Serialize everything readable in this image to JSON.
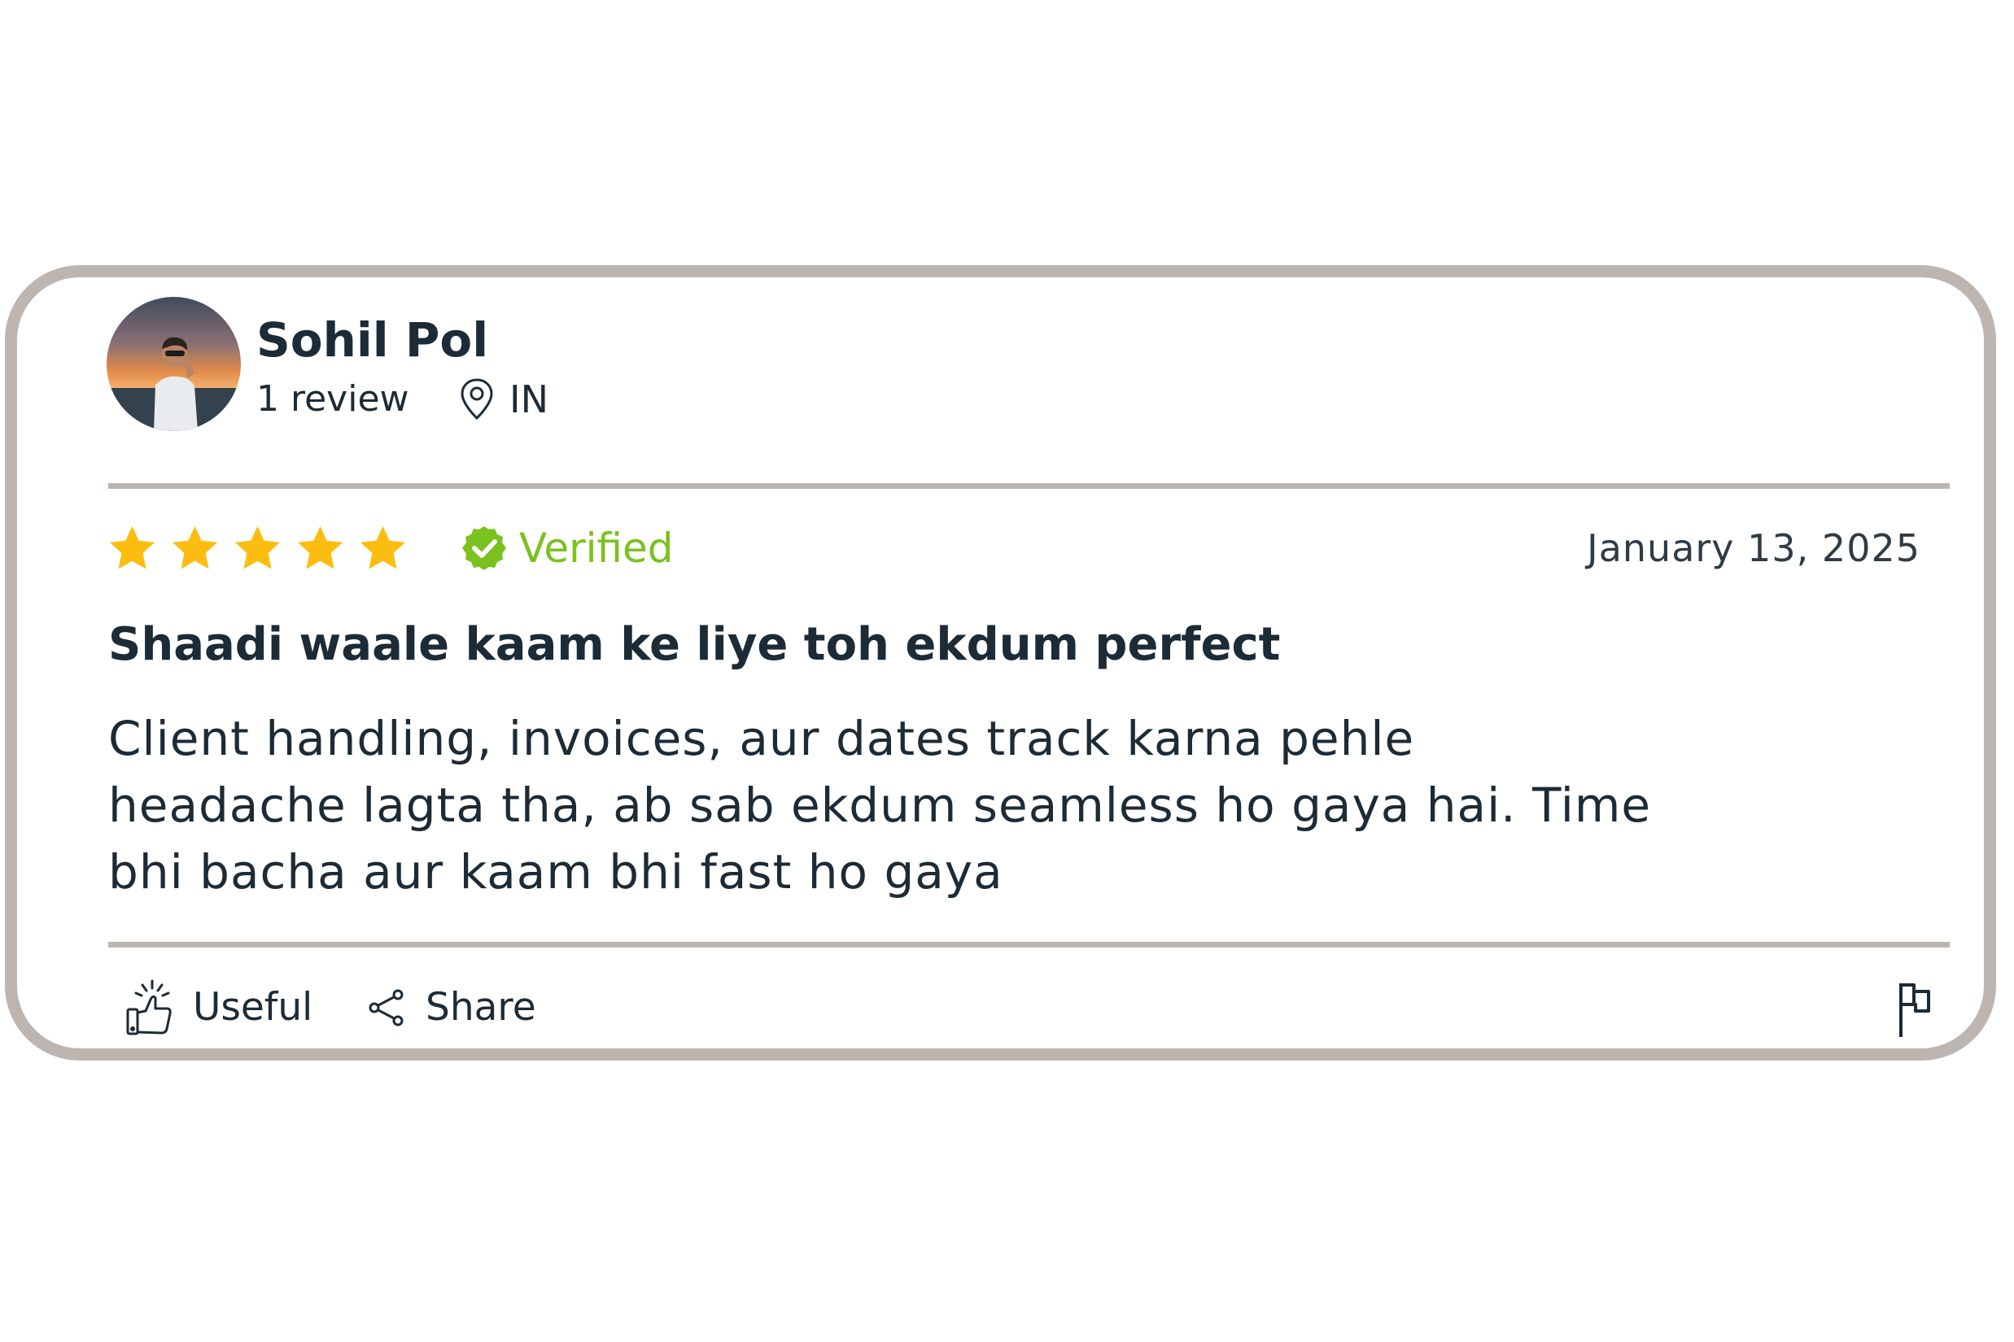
{
  "reviewer": {
    "name": "Sohil Pol",
    "review_count": "1 review",
    "location": "IN"
  },
  "rating": {
    "stars": 5,
    "max_stars": 5,
    "star_color": "#fdbd10",
    "verified_label": "Verified",
    "verified_color": "#7bc11f"
  },
  "review": {
    "date": "January 13, 2025",
    "title": "Shaadi waale kaam ke liye toh ekdum perfect",
    "body_lines": [
      "Client handling, invoices, aur dates track karna pehle",
      "headache lagta tha, ab sab ekdum seamless ho gaya hai. Time",
      "bhi bacha aur kaam bhi fast ho gaya"
    ]
  },
  "actions": {
    "useful_label": "Useful",
    "share_label": "Share"
  },
  "icons": {
    "location": "map-pin-icon",
    "verified": "check-badge-icon",
    "useful": "thumbs-up-icon",
    "share": "share-icon",
    "report": "flag-icon"
  },
  "colors": {
    "border": "#bdb5b0",
    "text": "#1c2b36"
  }
}
